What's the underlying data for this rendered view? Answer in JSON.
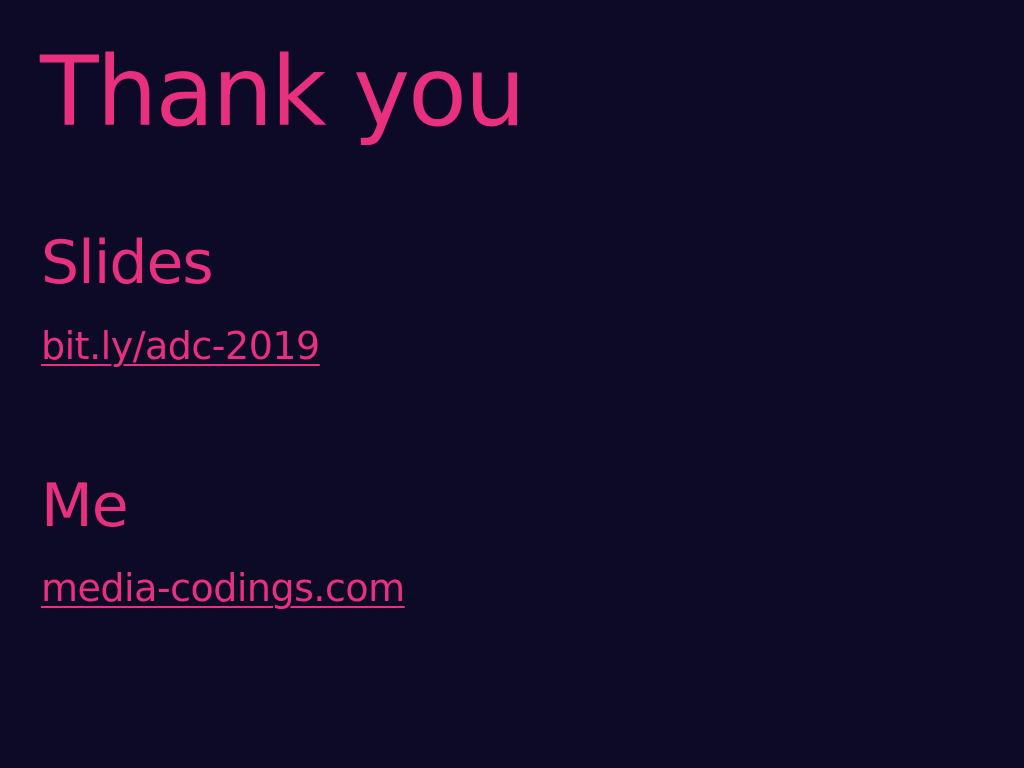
{
  "title": "Thank you",
  "sections": [
    {
      "heading": "Slides",
      "link": "bit.ly/adc-2019"
    },
    {
      "heading": "Me",
      "link": "media-codings.com"
    }
  ],
  "colors": {
    "background": "#0d0a27",
    "accent": "#e8307f"
  }
}
